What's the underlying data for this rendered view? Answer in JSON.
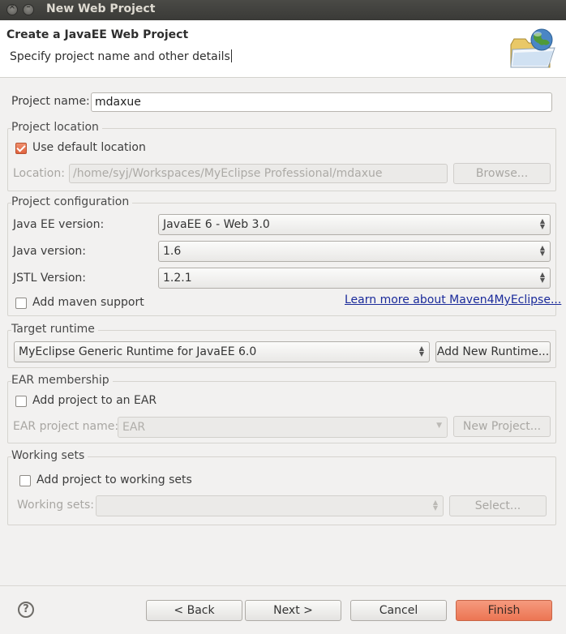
{
  "window": {
    "title": "New Web Project"
  },
  "header": {
    "title": "Create a JavaEE Web Project",
    "description": "Specify project name and other details",
    "icon": "folder-globe-icon"
  },
  "project_name": {
    "label": "Project name:",
    "value": "mdaxue"
  },
  "project_location": {
    "group_label": "Project location",
    "use_default_label": "Use default location",
    "use_default_checked": true,
    "location_label": "Location:",
    "location_value": "/home/syj/Workspaces/MyEclipse Professional/mdaxue",
    "browse_label": "Browse..."
  },
  "project_configuration": {
    "group_label": "Project configuration",
    "javaee_label": "Java EE version:",
    "javaee_value": "JavaEE 6 - Web 3.0",
    "java_label": "Java version:",
    "java_value": "1.6",
    "jstl_label": "JSTL Version:",
    "jstl_value": "1.2.1",
    "maven_label": "Add maven support",
    "maven_checked": false,
    "maven_link": "Learn more about Maven4MyEclipse..."
  },
  "target_runtime": {
    "group_label": "Target runtime",
    "runtime_value": "MyEclipse Generic Runtime for JavaEE 6.0",
    "add_runtime_label": "Add New Runtime..."
  },
  "ear_membership": {
    "group_label": "EAR membership",
    "add_ear_label": "Add project to an EAR",
    "add_ear_checked": false,
    "ear_name_label": "EAR project name:",
    "ear_name_value": "EAR",
    "new_project_label": "New Project..."
  },
  "working_sets": {
    "group_label": "Working sets",
    "add_label": "Add project to working sets",
    "add_checked": false,
    "sets_label": "Working sets:",
    "sets_value": "",
    "select_label": "Select..."
  },
  "footer": {
    "help_icon": "help-icon",
    "back_label": "< Back",
    "next_label": "Next >",
    "cancel_label": "Cancel",
    "finish_label": "Finish"
  },
  "colors": {
    "accent": "#ec7553",
    "link": "#1a2a9a",
    "titlebar": "#3c3b37"
  }
}
